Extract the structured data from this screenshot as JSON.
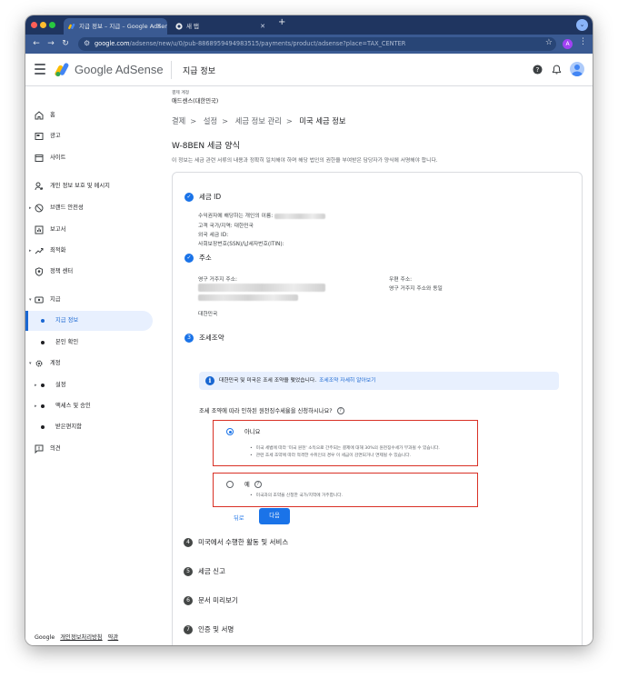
{
  "browser": {
    "tabs": [
      {
        "title": "지급 정보 – 지급 – Google AdSense",
        "active": true
      },
      {
        "title": "새 탭",
        "active": false
      }
    ],
    "url_host": "google.com",
    "url_path": "/adsense/new/u/0/pub-8868959494983515/payments/product/adsense?place=TAX_CENTER",
    "profile_initial": "A"
  },
  "header": {
    "brand": "Google AdSense",
    "page_title": "지급 정보"
  },
  "sidebar": {
    "items": [
      {
        "label": "홈",
        "icon": "home-icon"
      },
      {
        "label": "광고",
        "icon": "ads-icon"
      },
      {
        "label": "사이트",
        "icon": "sites-icon"
      },
      {
        "label": "개인 정보 보호 및 메시지",
        "icon": "privacy-icon"
      },
      {
        "label": "브랜드 안전성",
        "icon": "brand-safety-icon"
      },
      {
        "label": "보고서",
        "icon": "reports-icon"
      },
      {
        "label": "최적화",
        "icon": "optimization-icon"
      },
      {
        "label": "정책 센터",
        "icon": "policy-icon"
      },
      {
        "label": "지급",
        "icon": "payments-icon"
      },
      {
        "label": "지급 정보"
      },
      {
        "label": "본인 확인"
      },
      {
        "label": "계정",
        "icon": "account-gear-icon"
      },
      {
        "label": "설정"
      },
      {
        "label": "액세스 및 승인"
      },
      {
        "label": "받은편지함"
      },
      {
        "label": "의견",
        "icon": "feedback-icon"
      }
    ],
    "footer": {
      "google": "Google",
      "privacy": "개인정보처리방침",
      "terms": "약관"
    }
  },
  "main": {
    "account_label": "결제 계정",
    "account_name": "애드센스(대한민국)",
    "breadcrumbs": [
      "결제",
      "설정",
      "세금 정보 관리",
      "미국 세금 정보"
    ],
    "form_title": "W-8BEN 세금 양식",
    "description": "이 정보는 세금 관련 서류의 내용과 정확히 일치해야 하며 해당 법인의 권한을 부여받은 담당자가 양식에 서명해야 합니다.",
    "steps": {
      "tax_id": {
        "title": "세금 ID",
        "rows": [
          "수익권자에 해당하는 개인의 이름:",
          "고객 국가/지역: 대한민국",
          "외국 세금 ID:",
          "사회보장번호(SSN)/납세자번호(ITIN):"
        ]
      },
      "address": {
        "title": "주소",
        "permanent_label": "영구 거주지 주소:",
        "country": "대한민국",
        "mailing_label": "우편 주소:",
        "mailing_value": "영구 거주지 주소와 동일"
      },
      "treaty": {
        "number": "3",
        "title": "조세조약",
        "info": "대한민국 및 미국은 조세 조약을 맺었습니다.",
        "info_link": "조세조약 자세히 알아보기",
        "question": "조세 조약에 따라 인하된 원천징수세율을 신청하시나요?",
        "option_no": "아니요",
        "option_no_bullets": [
          "미국 세법에 따라 '미국 원천' 소득으로 간주되는 결제에 대해 30%의 원천징수세가 부과될 수 있습니다.",
          "관련 조세 조약에 따라 적격한 수취인의 경우 이 세금이 감면되거나 면제될 수 있습니다."
        ],
        "option_yes": "예",
        "option_yes_bullets": [
          "미국과의 조약을 신청한 국가/지역에 거주합니다."
        ],
        "back": "뒤로",
        "next": "다음"
      },
      "upcoming": [
        {
          "number": "4",
          "title": "미국에서 수행한 활동 및 서비스"
        },
        {
          "number": "5",
          "title": "세금 신고"
        },
        {
          "number": "6",
          "title": "문서 미리보기"
        },
        {
          "number": "7",
          "title": "인증 및 서명"
        }
      ]
    }
  }
}
